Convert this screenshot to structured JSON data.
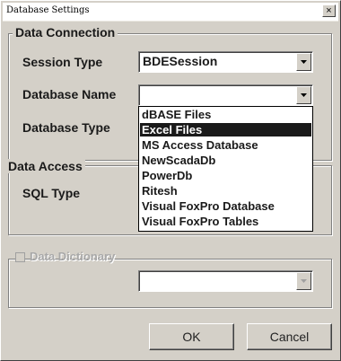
{
  "window": {
    "title": "Database Settings",
    "close_glyph": "×"
  },
  "data_connection": {
    "legend": "Data Connection",
    "session_type_label": "Session Type",
    "session_type_value": "BDESession",
    "database_name_label": "Database Name",
    "database_name_value": "",
    "database_type_label": "Database Type",
    "database_name_options": [
      "dBASE Files",
      "Excel Files",
      "MS Access Database",
      "NewScadaDb",
      "PowerDb",
      "Ritesh",
      "Visual FoxPro Database",
      "Visual FoxPro Tables"
    ],
    "highlighted_option": "Excel Files"
  },
  "data_access": {
    "legend": "Data Access",
    "sql_type_label": "SQL Type"
  },
  "data_dictionary": {
    "label": "Data Dictionary",
    "checked": false,
    "enabled": false,
    "value": ""
  },
  "buttons": {
    "ok": "OK",
    "cancel": "Cancel"
  },
  "colors": {
    "face": "#d4d0c8",
    "highlight": "#1a1a1a"
  },
  "icons": {
    "dropdown_arrow": "chevron-down-icon",
    "close": "close-icon"
  }
}
